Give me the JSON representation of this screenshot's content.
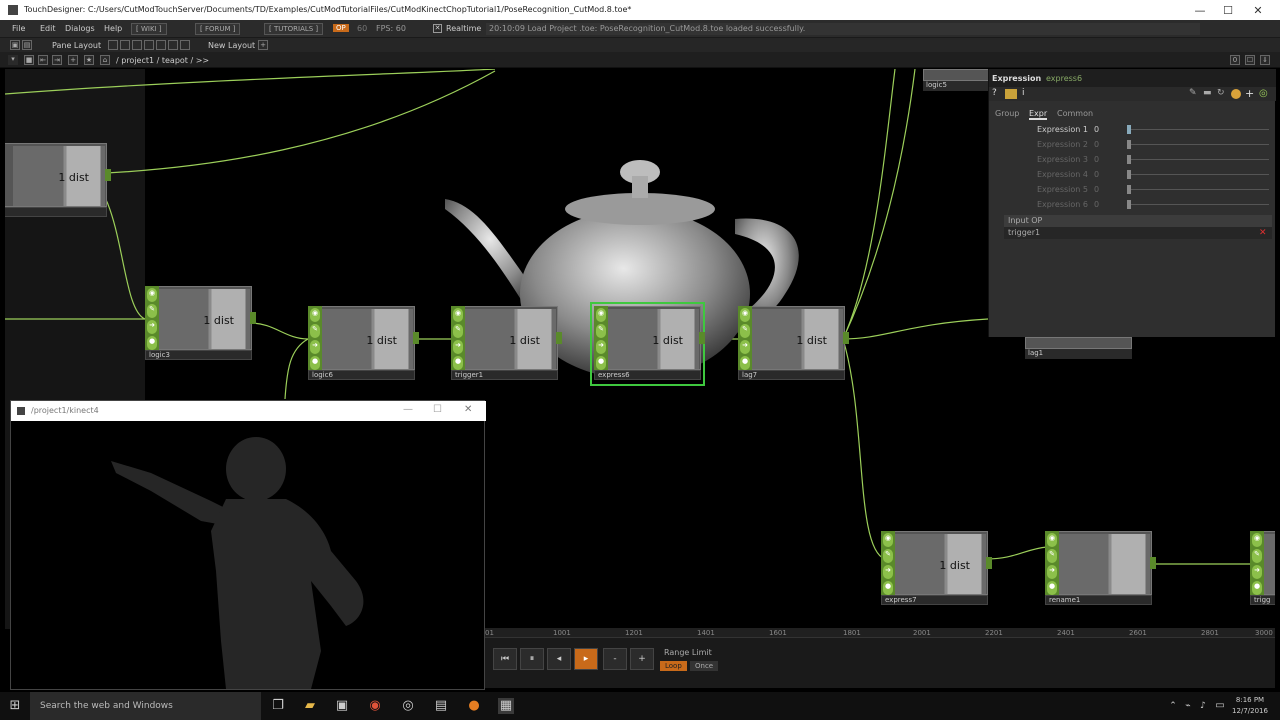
{
  "window": {
    "title": "TouchDesigner: C:/Users/CutModTouchServer/Documents/TD/Examples/CutModTutorialFiles/CutModKinectChopTutorial1/PoseRecognition_CutMod.8.toe*",
    "minimize": "—",
    "maximize": "☐",
    "close": "✕"
  },
  "menu": {
    "items": [
      "File",
      "Edit",
      "Dialogs",
      "Help"
    ],
    "wiki": "[ WIKI ]",
    "forum": "[ FORUM ]",
    "tutorials": "[ TUTORIALS ]",
    "op_badge": "OP",
    "fps_left": "60",
    "fps": "FPS: 60",
    "realtime": "Realtime",
    "status": "20:10:09 Load Project .toe: PoseRecognition_CutMod.8.toe loaded successfully."
  },
  "toolbar": {
    "pane_layout": "Pane Layout",
    "new_layout": "New Layout",
    "path": "/ project1 / teapot / >>"
  },
  "nodes": [
    {
      "id": "n0",
      "label": "",
      "text": "1 dist"
    },
    {
      "id": "logic3",
      "label": "logic3",
      "text": "1 dist"
    },
    {
      "id": "logic6",
      "label": "logic6",
      "text": "1 dist"
    },
    {
      "id": "trigger1",
      "label": "trigger1",
      "text": "1 dist"
    },
    {
      "id": "express6",
      "label": "express6",
      "text": "1 dist"
    },
    {
      "id": "lag7",
      "label": "lag7",
      "text": "1 dist"
    },
    {
      "id": "express7",
      "label": "express7",
      "text": "1 dist"
    },
    {
      "id": "rename1",
      "label": "rename1",
      "text": ""
    },
    {
      "id": "logic5",
      "label": "logic5",
      "text": ""
    },
    {
      "id": "lag1",
      "label": "lag1",
      "text": ""
    },
    {
      "id": "trigg",
      "label": "trigg",
      "text": ""
    }
  ],
  "params": {
    "op_type": "Expression",
    "op_name": "express6",
    "tabs": [
      "Group",
      "Expr",
      "Common"
    ],
    "active_tab": "Expr",
    "rows": [
      {
        "name": "Expression 1",
        "value": "0"
      },
      {
        "name": "Expression 2",
        "value": "0"
      },
      {
        "name": "Expression 3",
        "value": "0"
      },
      {
        "name": "Expression 4",
        "value": "0"
      },
      {
        "name": "Expression 5",
        "value": "0"
      },
      {
        "name": "Expression 6",
        "value": "0"
      }
    ],
    "input_op_label": "Input OP",
    "input_op_value": "trigger1"
  },
  "viewer": {
    "title": "/project1/kinect4",
    "minimize": "—",
    "maximize": "☐",
    "close": "✕"
  },
  "timeline": {
    "ticks": [
      "01",
      "1001",
      "1201",
      "1401",
      "1601",
      "1801",
      "2001",
      "2201",
      "2401",
      "2601",
      "2801",
      "3000"
    ],
    "range_limit": "Range Limit",
    "loop": "Loop",
    "once": "Once",
    "controls": [
      "⏮",
      "⏸",
      "◂",
      "▸",
      "-",
      "+"
    ]
  },
  "taskbar": {
    "search_placeholder": "Search the web and Windows",
    "time": "8:16 PM",
    "date": "12/7/2016"
  },
  "colors": {
    "node_green": "#5a8a2a",
    "wire_green": "#9ccf5a",
    "selection": "#3fc83f"
  }
}
